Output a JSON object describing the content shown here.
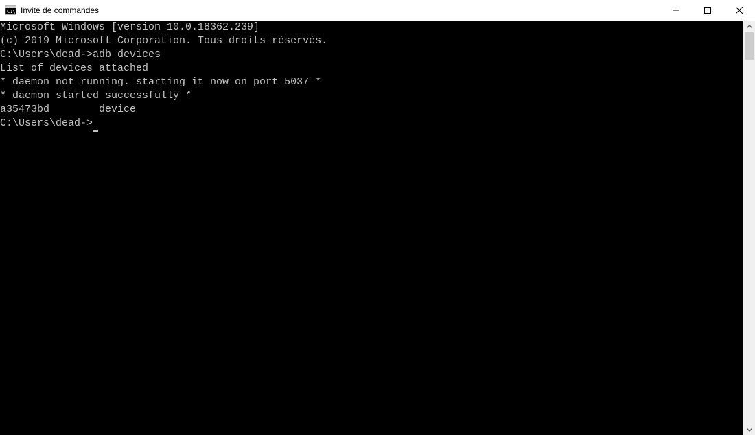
{
  "window": {
    "title": "Invite de commandes"
  },
  "terminal": {
    "lines": [
      "Microsoft Windows [version 10.0.18362.239]",
      "(c) 2019 Microsoft Corporation. Tous droits réservés.",
      "",
      "C:\\Users\\dead->adb devices",
      "List of devices attached",
      "* daemon not running. starting it now on port 5037 *",
      "* daemon started successfully *",
      "a35473bd        device",
      "",
      ""
    ],
    "prompt": "C:\\Users\\dead->"
  }
}
